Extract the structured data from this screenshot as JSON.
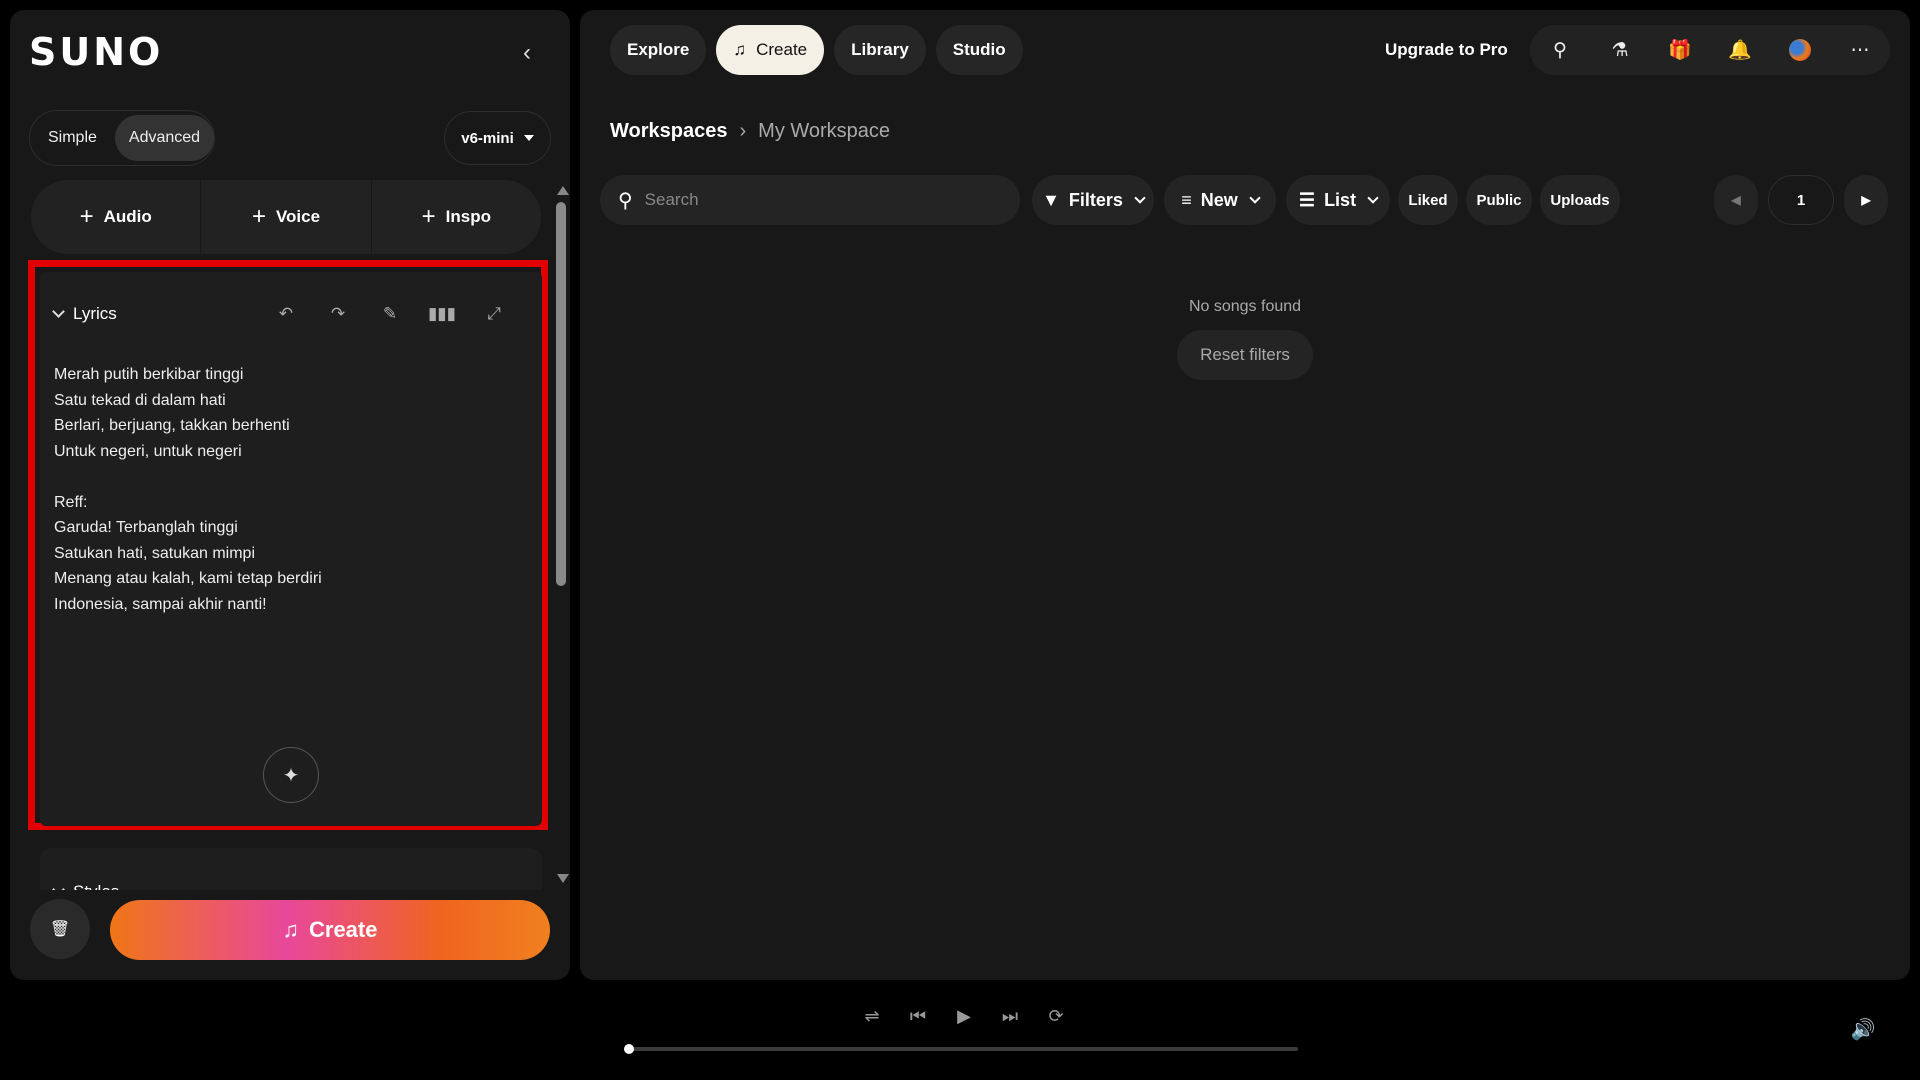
{
  "sidebar": {
    "logo": "SUNO",
    "mode": {
      "simple": "Simple",
      "advanced": "Advanced",
      "selected": "Advanced"
    },
    "version": "v6-mini",
    "add": {
      "audio": "Audio",
      "voice": "Voice",
      "inspo": "Inspo"
    },
    "lyrics": {
      "title": "Lyrics",
      "text": "Merah putih berkibar tinggi\nSatu tekad di dalam hati\nBerlari, berjuang, takkan berhenti\nUntuk negeri, untuk negeri\n\nReff:\nGaruda! Terbanglah tinggi\nSatukan hati, satukan mimpi\nMenang atau kalah, kami tetap berdiri\nIndonesia, sampai akhir nanti!"
    },
    "styles": {
      "title": "Styles"
    },
    "create_label": "Create",
    "scroll_position": 0.0
  },
  "nav": {
    "explore": "Explore",
    "create": "Create",
    "library": "Library",
    "studio": "Studio",
    "active": "Create",
    "upgrade": "Upgrade to Pro",
    "icons": [
      "search-icon",
      "flask-icon",
      "gift-icon",
      "bell-icon",
      "avatar",
      "more-icon"
    ]
  },
  "breadcrumb": {
    "root": "Workspaces",
    "current": "My Workspace"
  },
  "toolbar": {
    "search_placeholder": "Search",
    "filters": "Filters",
    "sort": "New",
    "view": "List",
    "liked": "Liked",
    "public": "Public",
    "uploads": "Uploads",
    "page": "1"
  },
  "content": {
    "empty": "No songs found",
    "reset": "Reset filters"
  },
  "player": {
    "progress": 0.0
  },
  "colors": {
    "accent_outline": "#e10000",
    "create_gradient_start": "#f07616",
    "create_gradient_mid": "#e8489a"
  }
}
